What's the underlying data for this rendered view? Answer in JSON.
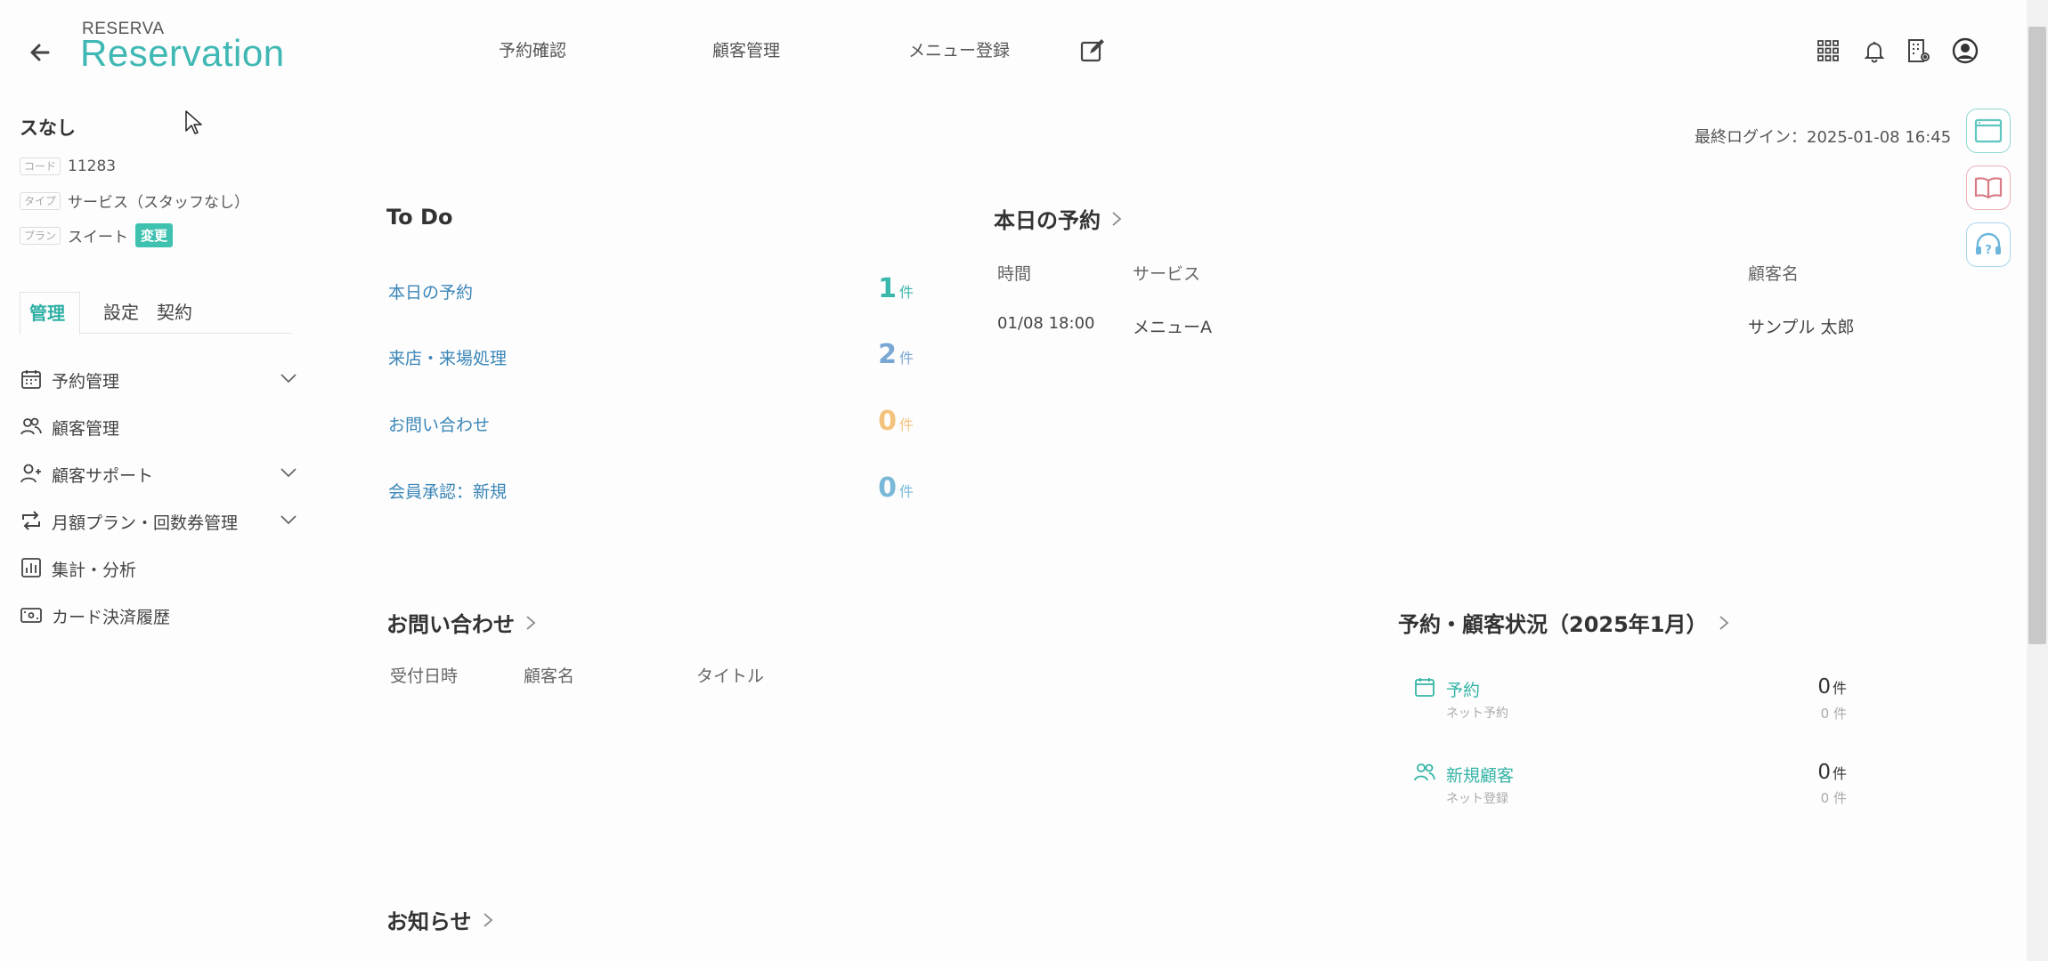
{
  "header": {
    "logo_top": "RESERVA",
    "logo_main": "Reservation",
    "nav": [
      "予約確認",
      "顧客管理",
      "メニュー登録"
    ],
    "icons": [
      "back-arrow-icon",
      "edit-icon",
      "apps-grid-icon",
      "bell-icon",
      "building-settings-icon",
      "user-avatar-icon"
    ]
  },
  "business": {
    "name": "スなし",
    "code_tag": "コード",
    "code": "11283",
    "type_tag": "タイプ",
    "type": "サービス（スタッフなし）",
    "plan_tag": "プラン",
    "plan": "スイート",
    "change_label": "変更"
  },
  "side_tabs": [
    "管理",
    "設定",
    "契約"
  ],
  "side_menu": [
    {
      "label": "予約管理",
      "icon": "calendar-icon",
      "expandable": true
    },
    {
      "label": "顧客管理",
      "icon": "users-icon",
      "expandable": false
    },
    {
      "label": "顧客サポート",
      "icon": "user-plus-icon",
      "expandable": true
    },
    {
      "label": "月額プラン・回数券管理",
      "icon": "repeat-icon",
      "expandable": true
    },
    {
      "label": "集計・分析",
      "icon": "bar-chart-icon",
      "expandable": false
    },
    {
      "label": "カード決済履歴",
      "icon": "credit-card-icon",
      "expandable": false
    }
  ],
  "last_login": "最終ログイン：2025-01-08 16:45",
  "todo": {
    "title": "To Do",
    "unit": "件",
    "items": [
      {
        "label": "本日の予約",
        "count": "1",
        "color": "#3ab7ad"
      },
      {
        "label": "来店・来場処理",
        "count": "2",
        "color": "#7aa6d3"
      },
      {
        "label": "お問い合わせ",
        "count": "0",
        "color": "#f3c37e"
      },
      {
        "label": "会員承認：新規",
        "count": "0",
        "color": "#7ab8d8"
      }
    ]
  },
  "today_reservations": {
    "title": "本日の予約",
    "headers": [
      "時間",
      "サービス",
      "顧客名"
    ],
    "rows": [
      {
        "time": "01/08 18:00",
        "service": "メニューA",
        "customer": "サンプル 太郎"
      }
    ]
  },
  "inquiries": {
    "title": "お問い合わせ",
    "headers": [
      "受付日時",
      "顧客名",
      "タイトル"
    ]
  },
  "status": {
    "title": "予約・顧客状況（2025年1月）",
    "unit": "件",
    "items": [
      {
        "label": "予約",
        "sub": "ネット予約",
        "value": "0",
        "sub_value": "0",
        "icon": "calendar-icon"
      },
      {
        "label": "新規顧客",
        "sub": "ネット登録",
        "value": "0",
        "sub_value": "0",
        "icon": "users-icon"
      }
    ]
  },
  "news": {
    "title": "お知らせ"
  },
  "colors": {
    "accent": "#3fb8b4",
    "link": "#3b86b8",
    "float_teal": "#5ec5c0",
    "float_red": "#d97b86",
    "float_blue": "#6cb6dd"
  }
}
